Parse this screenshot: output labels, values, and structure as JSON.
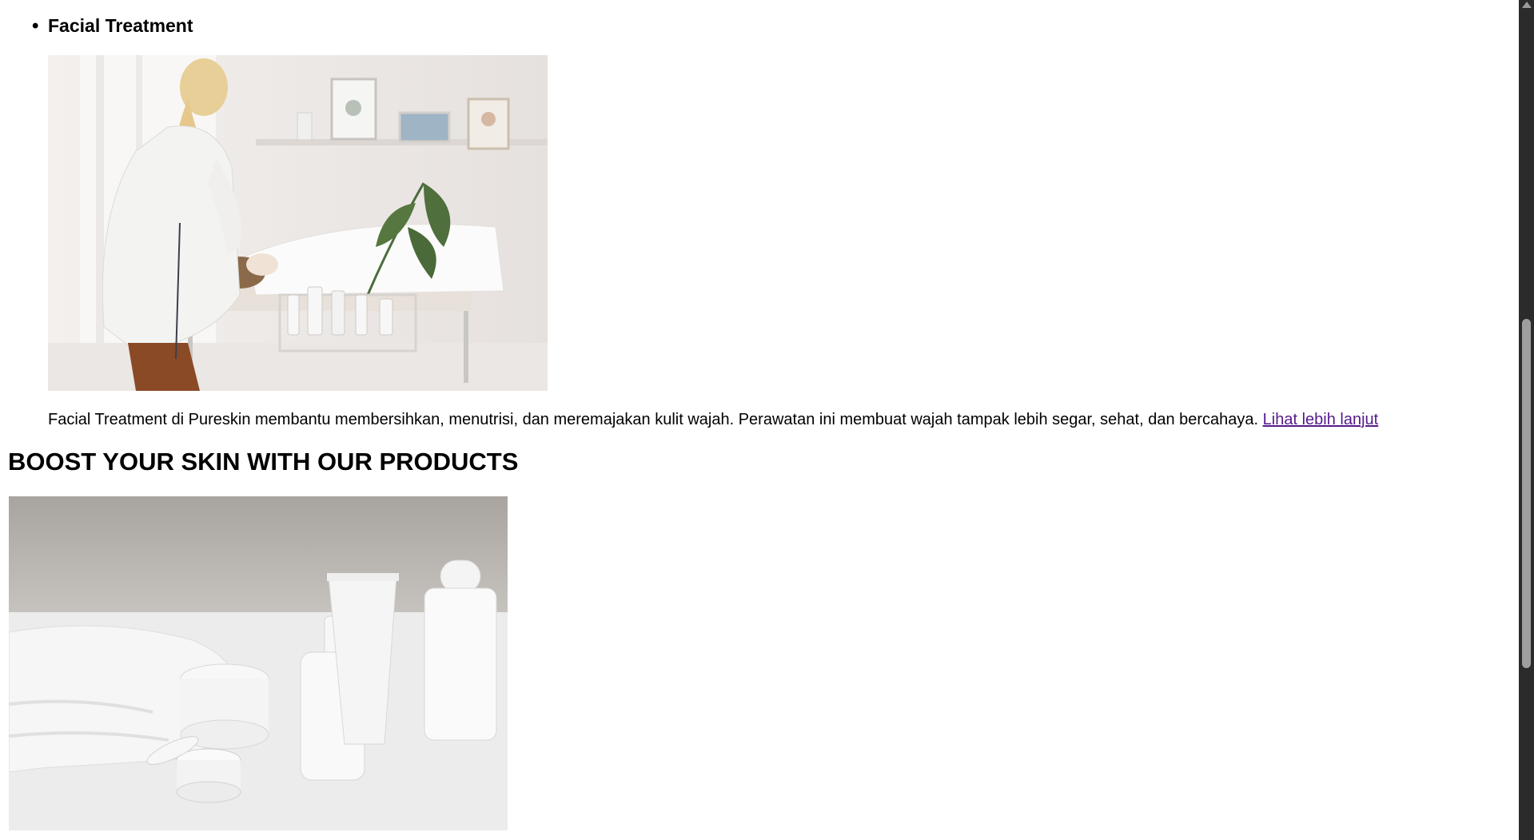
{
  "treatment": {
    "title": "Facial Treatment",
    "description": "Facial Treatment di Pureskin membantu membersihkan, menutrisi, dan meremajakan kulit wajah. Perawatan ini membuat wajah tampak lebih segar, sehat, dan bercahaya.",
    "link_label": "Lihat lebih lanjut"
  },
  "products": {
    "heading": "BOOST YOUR SKIN WITH OUR PRODUCTS"
  },
  "colors": {
    "link_visited": "#551a8b",
    "scrollbar_track": "#2b2b2b",
    "scrollbar_thumb": "#9f9f9f"
  }
}
